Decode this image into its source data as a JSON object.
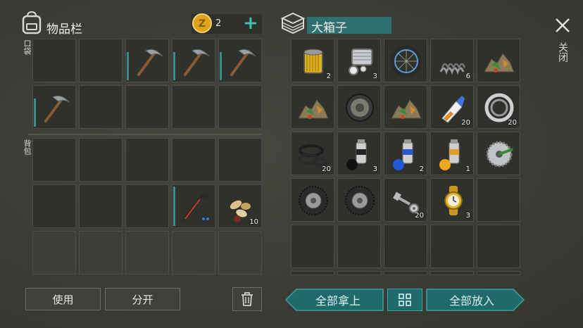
{
  "inventory": {
    "title": "物品栏",
    "coins": "2",
    "add_symbol": "+",
    "pocket_label": "口袋",
    "backpack_label": "背包",
    "pocket_slots": [
      "",
      "",
      "pickaxe",
      "pickaxe",
      "pickaxe",
      "pickaxe",
      "",
      "",
      "",
      ""
    ],
    "backpack_slots": [
      "",
      "",
      "",
      "",
      "",
      "",
      "",
      "",
      "crowbar",
      "seeds"
    ],
    "seeds_qty": "10",
    "use_label": "使用",
    "split_label": "分开"
  },
  "container": {
    "title": "大箱子",
    "close_label": "关闭",
    "take_all_label": "全部拿上",
    "put_all_label": "全部放入",
    "items": [
      {
        "icon": "oil-filter",
        "qty": "2"
      },
      {
        "icon": "engine-parts",
        "qty": "3"
      },
      {
        "icon": "bicycle-wheel",
        "qty": ""
      },
      {
        "icon": "spring",
        "qty": "6"
      },
      {
        "icon": "ore-pile",
        "qty": ""
      },
      {
        "icon": "ore-pile",
        "qty": ""
      },
      {
        "icon": "brake-disc",
        "qty": ""
      },
      {
        "icon": "ore-pile",
        "qty": ""
      },
      {
        "icon": "glue-tube",
        "qty": "20"
      },
      {
        "icon": "bearing",
        "qty": "20"
      },
      {
        "icon": "rubber-gaskets",
        "qty": "20"
      },
      {
        "icon": "spray-paint-black",
        "qty": "3"
      },
      {
        "icon": "spray-paint-blue",
        "qty": "2"
      },
      {
        "icon": "spray-paint-yellow",
        "qty": "1"
      },
      {
        "icon": "saw-blade",
        "qty": ""
      },
      {
        "icon": "tire",
        "qty": ""
      },
      {
        "icon": "tire",
        "qty": ""
      },
      {
        "icon": "bolts",
        "qty": "20"
      },
      {
        "icon": "gold-watch",
        "qty": "3"
      },
      {
        "icon": "",
        "qty": ""
      }
    ]
  },
  "colors": {
    "accent_teal": "#1f6b6b",
    "coin": "#e0a21a",
    "durability": "#3f8a8a"
  }
}
